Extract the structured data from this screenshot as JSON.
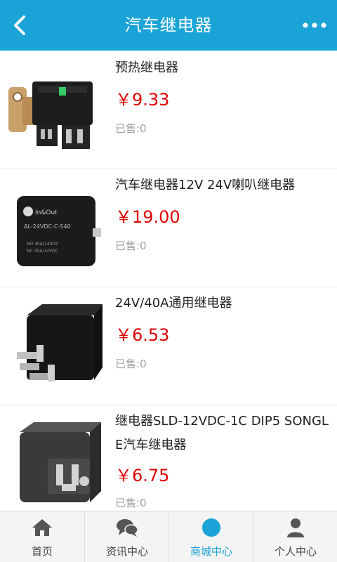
{
  "header": {
    "title": "汽车继电器",
    "back_icon": "chevron-left-icon",
    "more_icon": "more-dots-icon",
    "color": "#1aa3d6"
  },
  "products": [
    {
      "name": "预热继电器",
      "price": "￥9.33",
      "sold": "已售:0"
    },
    {
      "name": "汽车继电器12V 24V喇叭继电器",
      "price": "￥19.00",
      "sold": "已售:0"
    },
    {
      "name": "24V/40A通用继电器",
      "price": "￥6.53",
      "sold": "已售:0"
    },
    {
      "name": "继电器SLD-12VDC-1C DIP5 SONGLE汽车继电器",
      "price": "￥6.75",
      "sold": "已售:0"
    }
  ],
  "product_images": {
    "item2_brand": "In&Out",
    "item2_model": "AL-24VDC-C-S40",
    "item2_spec1": "NO 40A/14VDC",
    "item2_spec2": "NC 30A/14VDC"
  },
  "tabbar": {
    "tabs": [
      {
        "label": "首页",
        "icon": "home-icon"
      },
      {
        "label": "资讯中心",
        "icon": "chat-bubbles-icon"
      },
      {
        "label": "商城中心",
        "icon": "circle-icon"
      },
      {
        "label": "个人中心",
        "icon": "person-icon"
      }
    ],
    "active_index": 2,
    "active_color": "#1aa3d6",
    "price_color": "#e00000"
  }
}
